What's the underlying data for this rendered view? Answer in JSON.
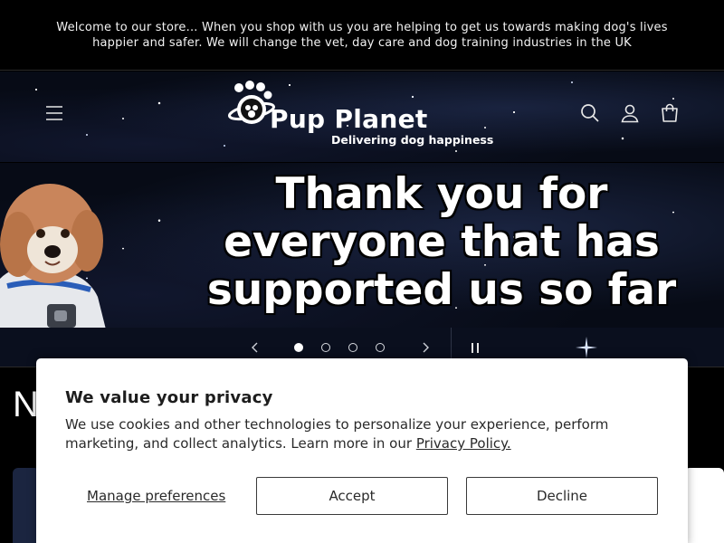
{
  "announcement": {
    "text": "Welcome to our store... When you shop with us you are helping to get us towards making dog's lives happier and safer. We will change the vet, day care and dog training industries in the UK"
  },
  "header": {
    "menu_icon": "hamburger-menu-icon",
    "search_icon": "search-icon",
    "account_icon": "account-icon",
    "cart_icon": "cart-icon",
    "logo": {
      "name": "Pup Planet",
      "tagline": "Delivering dog happiness"
    }
  },
  "hero": {
    "slide_text": "Thank you for everyone that has supported us so far",
    "slide_count": 4,
    "active_slide": 1
  },
  "slider": {
    "prev_icon": "chevron-left-icon",
    "next_icon": "chevron-right-icon",
    "pause_icon": "pause-icon"
  },
  "background": {
    "heading_fragment": "N"
  },
  "consent": {
    "title": "We value your privacy",
    "description": "We use cookies and other technologies to personalize your experience, perform marketing, and collect analytics. Learn more in our",
    "policy_link": "Privacy Policy.",
    "manage_label": "Manage preferences",
    "accept_label": "Accept",
    "decline_label": "Decline"
  },
  "colors": {
    "page_background": "#000000",
    "space_background": "#070b16",
    "dialog_background": "#ffffff",
    "text_dark": "#1d1d1d"
  }
}
